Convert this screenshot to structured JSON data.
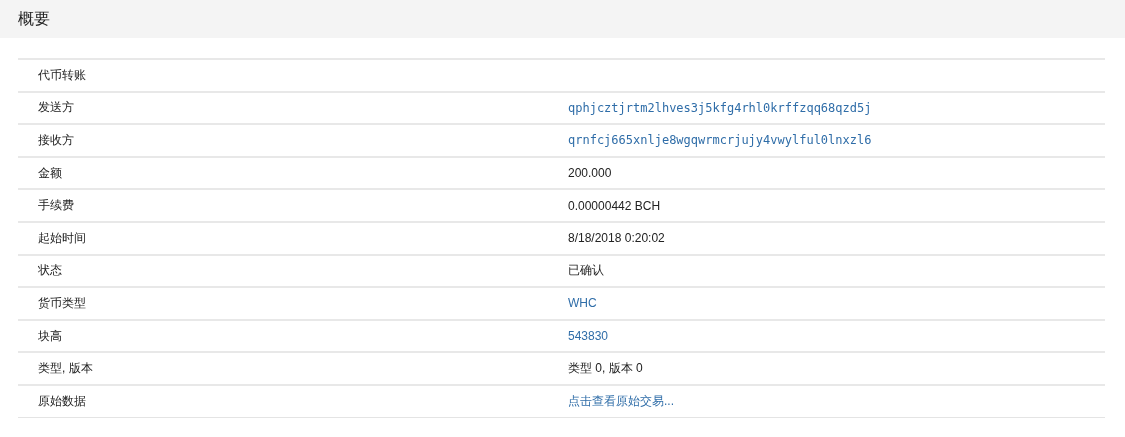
{
  "header": {
    "title": "概要"
  },
  "rows": [
    {
      "label": "代币转账"
    },
    {
      "label": "发送方",
      "value": "qphjcztjrtm2lhves3j5kfg4rhl0krffzqq68qzd5j",
      "kind": "hash"
    },
    {
      "label": "接收方",
      "value": "qrnfcj665xnlje8wgqwrmcrjujy4vwylful0lnxzl6",
      "kind": "hash"
    },
    {
      "label": "金额",
      "value": "200.000",
      "kind": "text"
    },
    {
      "label": "手续费",
      "value": "0.00000442 BCH",
      "kind": "text"
    },
    {
      "label": "起始时间",
      "value": "8/18/2018 0:20:02",
      "kind": "text"
    },
    {
      "label": "状态",
      "value": "已确认",
      "kind": "text"
    },
    {
      "label": "货币类型",
      "value": "WHC",
      "kind": "link"
    },
    {
      "label": "块高",
      "value": "543830",
      "kind": "link"
    },
    {
      "label": "类型, 版本",
      "value": "类型 0, 版本 0",
      "kind": "text"
    },
    {
      "label": "原始数据",
      "value": "点击查看原始交易...",
      "kind": "link"
    }
  ]
}
